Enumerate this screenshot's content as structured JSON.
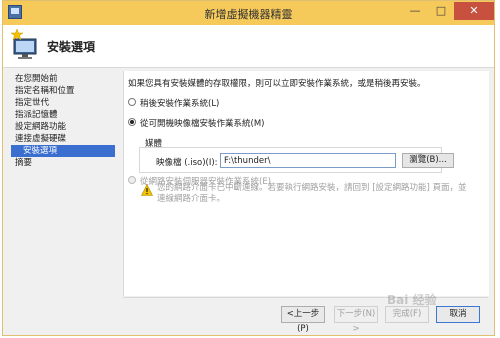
{
  "window": {
    "title": "新增虛擬機器精靈",
    "minimize": "—",
    "maximize": "□",
    "close": "✕"
  },
  "header": {
    "title": "安裝選項"
  },
  "sidebar": {
    "items": [
      {
        "label": "在您開始前",
        "active": false
      },
      {
        "label": "指定名稱和位置",
        "active": false
      },
      {
        "label": "指定世代",
        "active": false
      },
      {
        "label": "指派記憶體",
        "active": false
      },
      {
        "label": "設定網路功能",
        "active": false
      },
      {
        "label": "連接虛擬硬碟",
        "active": false
      },
      {
        "label": "安裝選項",
        "active": true
      },
      {
        "label": "摘要",
        "active": false
      }
    ]
  },
  "content": {
    "description": "如果您具有安裝媒體的存取權限，則可以立即安裝作業系統，或是稍後再安裝。",
    "option_later": "稍後安裝作業系統(L)",
    "option_image": "從可開機映像檔安裝作業系統(M)",
    "media_group_label": "媒體",
    "image_field_label": "映像檔 (.iso)(I):",
    "image_field_value": "F:\\thunder\\",
    "browse_button": "瀏覽(B)...",
    "option_network": "從網路安裝伺服器安裝作業系統(E)",
    "warning_text": "您的網路介面卡已中斷連線。若要執行網路安裝，請回到 [設定網路功能] 頁面，並連線網路介面卡。",
    "selected_option": "image"
  },
  "footer": {
    "back_button": "<上一步(P)",
    "next_button": "下一步(N) >",
    "finish_button": "完成(F)",
    "cancel_button": "取消"
  },
  "watermark": "Bai 经验",
  "colors": {
    "titlebar": "#f5c95a",
    "accent": "#3a6fd0",
    "close": "#c7503f"
  },
  "icons": {
    "wizard": "monitor-star-icon",
    "warning": "warning-triangle-icon"
  }
}
